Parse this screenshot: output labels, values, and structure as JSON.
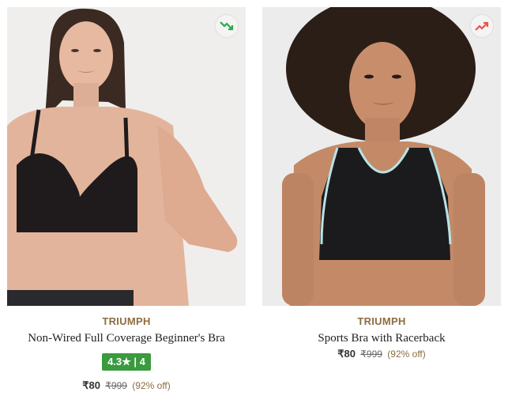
{
  "products": [
    {
      "brand": "TRIUMPH",
      "name": "Non-Wired Full Coverage Beginner's Bra",
      "rating": "4.3★ | 4",
      "price": "₹80",
      "mrp": "₹999",
      "discount": "(92% off)",
      "trend_icon": "trend-down-icon",
      "trend_color": "#2aa84a",
      "image_icon": "product-photo"
    },
    {
      "brand": "TRIUMPH",
      "name": "Sports Bra with Racerback",
      "price": "₹80",
      "mrp": "₹999",
      "discount": "(92% off)",
      "trend_icon": "trend-up-icon",
      "trend_color": "#e8534a",
      "image_icon": "product-photo"
    }
  ],
  "colors": {
    "brand": "#8d6d3f",
    "rating_bg": "#3a9a3e"
  }
}
